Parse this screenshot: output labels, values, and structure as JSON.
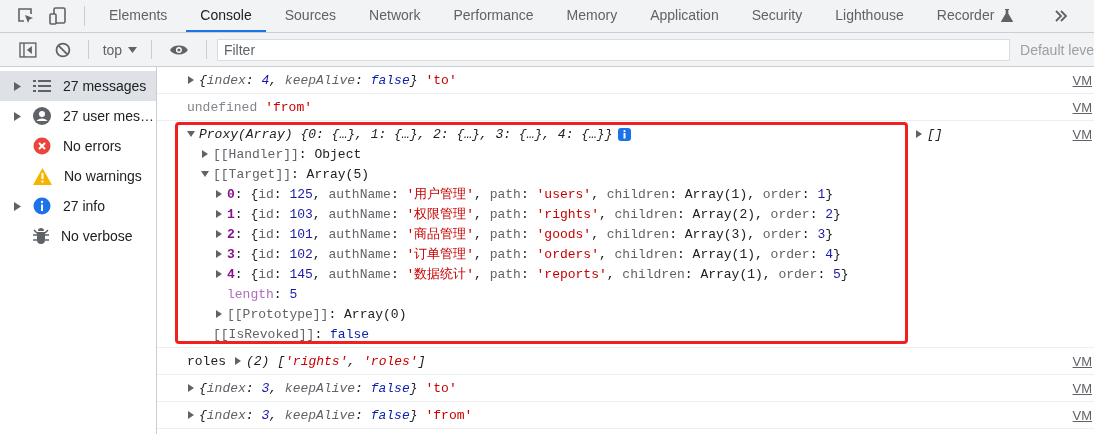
{
  "tabs": [
    {
      "label": "Elements",
      "selected": false
    },
    {
      "label": "Console",
      "selected": true
    },
    {
      "label": "Sources",
      "selected": false
    },
    {
      "label": "Network",
      "selected": false
    },
    {
      "label": "Performance",
      "selected": false
    },
    {
      "label": "Memory",
      "selected": false
    },
    {
      "label": "Application",
      "selected": false
    },
    {
      "label": "Security",
      "selected": false
    },
    {
      "label": "Lighthouse",
      "selected": false
    },
    {
      "label": "Recorder",
      "selected": false,
      "experimental": true
    }
  ],
  "toolbar": {
    "context": "top",
    "filter": {
      "placeholder": "Filter"
    },
    "levels": "Default leve"
  },
  "sidebar": {
    "items": [
      {
        "label": "27 messages",
        "kind": "list",
        "expandable": true,
        "selected": true
      },
      {
        "label": "27 user mes…",
        "kind": "user",
        "expandable": true,
        "selected": false
      },
      {
        "label": "No errors",
        "kind": "error",
        "expandable": false,
        "selected": false
      },
      {
        "label": "No warnings",
        "kind": "warning",
        "expandable": false,
        "selected": false
      },
      {
        "label": "27 info",
        "kind": "info",
        "expandable": true,
        "selected": false
      },
      {
        "label": "No verbose",
        "kind": "verbose",
        "expandable": false,
        "selected": false
      }
    ]
  },
  "console": [
    {
      "source": "VM",
      "args": [
        {
          "kind": "expandable",
          "expanded": false,
          "parts": [
            {
              "kind": "iplain",
              "text": "{"
            },
            {
              "kind": "iprop",
              "text": "index"
            },
            {
              "kind": "iplain",
              "text": ": "
            },
            {
              "kind": "inum",
              "text": "4"
            },
            {
              "kind": "iplain",
              "text": ", "
            },
            {
              "kind": "iprop",
              "text": "keepAlive"
            },
            {
              "kind": "iplain",
              "text": ": "
            },
            {
              "kind": "ibool",
              "text": "false"
            },
            {
              "kind": "iplain",
              "text": "}"
            }
          ]
        },
        {
          "kind": "plain",
          "parts": [
            {
              "kind": "str",
              "text": "'to'"
            }
          ]
        }
      ]
    },
    {
      "source": "VM",
      "args": [
        {
          "kind": "plain",
          "parts": [
            {
              "kind": "muted",
              "text": "undefined"
            }
          ]
        },
        {
          "kind": "plain",
          "parts": [
            {
              "kind": "str",
              "text": "'from'"
            }
          ]
        }
      ]
    },
    {
      "source": "VM",
      "highlighted": true,
      "args": [
        {
          "kind": "expandable",
          "expanded": true,
          "info_badge": true,
          "parts": [
            {
              "kind": "iplain",
              "text": "Proxy(Array) {0: {…}, 1: {…}, 2: {…}, 3: {…}, 4: {…}}"
            }
          ],
          "children": [
            {
              "kind": "branch",
              "expanded": false,
              "parts": [
                {
                  "kind": "prop",
                  "text": "[[Handler]]"
                },
                {
                  "kind": "plain",
                  "text": ": Object"
                }
              ]
            },
            {
              "kind": "branch",
              "expanded": true,
              "parts": [
                {
                  "kind": "prop",
                  "text": "[[Target]]"
                },
                {
                  "kind": "plain",
                  "text": ": Array(5)"
                }
              ],
              "children": [
                {
                  "kind": "branch",
                  "expanded": false,
                  "parts": [
                    {
                      "kind": "index",
                      "text": "0"
                    },
                    {
                      "kind": "plain",
                      "text": ": {"
                    },
                    {
                      "kind": "prop",
                      "text": "id"
                    },
                    {
                      "kind": "plain",
                      "text": ": "
                    },
                    {
                      "kind": "num",
                      "text": "125"
                    },
                    {
                      "kind": "plain",
                      "text": ", "
                    },
                    {
                      "kind": "prop",
                      "text": "authName"
                    },
                    {
                      "kind": "plain",
                      "text": ": "
                    },
                    {
                      "kind": "str",
                      "text": "'用户管理'"
                    },
                    {
                      "kind": "plain",
                      "text": ", "
                    },
                    {
                      "kind": "prop",
                      "text": "path"
                    },
                    {
                      "kind": "plain",
                      "text": ": "
                    },
                    {
                      "kind": "str",
                      "text": "'users'"
                    },
                    {
                      "kind": "plain",
                      "text": ", "
                    },
                    {
                      "kind": "prop",
                      "text": "children"
                    },
                    {
                      "kind": "plain",
                      "text": ": Array(1), "
                    },
                    {
                      "kind": "prop",
                      "text": "order"
                    },
                    {
                      "kind": "plain",
                      "text": ": "
                    },
                    {
                      "kind": "num",
                      "text": "1"
                    },
                    {
                      "kind": "plain",
                      "text": "}"
                    }
                  ]
                },
                {
                  "kind": "branch",
                  "expanded": false,
                  "parts": [
                    {
                      "kind": "index",
                      "text": "1"
                    },
                    {
                      "kind": "plain",
                      "text": ": {"
                    },
                    {
                      "kind": "prop",
                      "text": "id"
                    },
                    {
                      "kind": "plain",
                      "text": ": "
                    },
                    {
                      "kind": "num",
                      "text": "103"
                    },
                    {
                      "kind": "plain",
                      "text": ", "
                    },
                    {
                      "kind": "prop",
                      "text": "authName"
                    },
                    {
                      "kind": "plain",
                      "text": ": "
                    },
                    {
                      "kind": "str",
                      "text": "'权限管理'"
                    },
                    {
                      "kind": "plain",
                      "text": ", "
                    },
                    {
                      "kind": "prop",
                      "text": "path"
                    },
                    {
                      "kind": "plain",
                      "text": ": "
                    },
                    {
                      "kind": "str",
                      "text": "'rights'"
                    },
                    {
                      "kind": "plain",
                      "text": ", "
                    },
                    {
                      "kind": "prop",
                      "text": "children"
                    },
                    {
                      "kind": "plain",
                      "text": ": Array(2), "
                    },
                    {
                      "kind": "prop",
                      "text": "order"
                    },
                    {
                      "kind": "plain",
                      "text": ": "
                    },
                    {
                      "kind": "num",
                      "text": "2"
                    },
                    {
                      "kind": "plain",
                      "text": "}"
                    }
                  ]
                },
                {
                  "kind": "branch",
                  "expanded": false,
                  "parts": [
                    {
                      "kind": "index",
                      "text": "2"
                    },
                    {
                      "kind": "plain",
                      "text": ": {"
                    },
                    {
                      "kind": "prop",
                      "text": "id"
                    },
                    {
                      "kind": "plain",
                      "text": ": "
                    },
                    {
                      "kind": "num",
                      "text": "101"
                    },
                    {
                      "kind": "plain",
                      "text": ", "
                    },
                    {
                      "kind": "prop",
                      "text": "authName"
                    },
                    {
                      "kind": "plain",
                      "text": ": "
                    },
                    {
                      "kind": "str",
                      "text": "'商品管理'"
                    },
                    {
                      "kind": "plain",
                      "text": ", "
                    },
                    {
                      "kind": "prop",
                      "text": "path"
                    },
                    {
                      "kind": "plain",
                      "text": ": "
                    },
                    {
                      "kind": "str",
                      "text": "'goods'"
                    },
                    {
                      "kind": "plain",
                      "text": ", "
                    },
                    {
                      "kind": "prop",
                      "text": "children"
                    },
                    {
                      "kind": "plain",
                      "text": ": Array(3), "
                    },
                    {
                      "kind": "prop",
                      "text": "order"
                    },
                    {
                      "kind": "plain",
                      "text": ": "
                    },
                    {
                      "kind": "num",
                      "text": "3"
                    },
                    {
                      "kind": "plain",
                      "text": "}"
                    }
                  ]
                },
                {
                  "kind": "branch",
                  "expanded": false,
                  "parts": [
                    {
                      "kind": "index",
                      "text": "3"
                    },
                    {
                      "kind": "plain",
                      "text": ": {"
                    },
                    {
                      "kind": "prop",
                      "text": "id"
                    },
                    {
                      "kind": "plain",
                      "text": ": "
                    },
                    {
                      "kind": "num",
                      "text": "102"
                    },
                    {
                      "kind": "plain",
                      "text": ", "
                    },
                    {
                      "kind": "prop",
                      "text": "authName"
                    },
                    {
                      "kind": "plain",
                      "text": ": "
                    },
                    {
                      "kind": "str",
                      "text": "'订单管理'"
                    },
                    {
                      "kind": "plain",
                      "text": ", "
                    },
                    {
                      "kind": "prop",
                      "text": "path"
                    },
                    {
                      "kind": "plain",
                      "text": ": "
                    },
                    {
                      "kind": "str",
                      "text": "'orders'"
                    },
                    {
                      "kind": "plain",
                      "text": ", "
                    },
                    {
                      "kind": "prop",
                      "text": "children"
                    },
                    {
                      "kind": "plain",
                      "text": ": Array(1), "
                    },
                    {
                      "kind": "prop",
                      "text": "order"
                    },
                    {
                      "kind": "plain",
                      "text": ": "
                    },
                    {
                      "kind": "num",
                      "text": "4"
                    },
                    {
                      "kind": "plain",
                      "text": "}"
                    }
                  ]
                },
                {
                  "kind": "branch",
                  "expanded": false,
                  "parts": [
                    {
                      "kind": "index",
                      "text": "4"
                    },
                    {
                      "kind": "plain",
                      "text": ": {"
                    },
                    {
                      "kind": "prop",
                      "text": "id"
                    },
                    {
                      "kind": "plain",
                      "text": ": "
                    },
                    {
                      "kind": "num",
                      "text": "145"
                    },
                    {
                      "kind": "plain",
                      "text": ", "
                    },
                    {
                      "kind": "prop",
                      "text": "authName"
                    },
                    {
                      "kind": "plain",
                      "text": ": "
                    },
                    {
                      "kind": "str",
                      "text": "'数据统计'"
                    },
                    {
                      "kind": "plain",
                      "text": ", "
                    },
                    {
                      "kind": "prop",
                      "text": "path"
                    },
                    {
                      "kind": "plain",
                      "text": ": "
                    },
                    {
                      "kind": "str",
                      "text": "'reports'"
                    },
                    {
                      "kind": "plain",
                      "text": ", "
                    },
                    {
                      "kind": "prop",
                      "text": "children"
                    },
                    {
                      "kind": "plain",
                      "text": ": Array(1), "
                    },
                    {
                      "kind": "prop",
                      "text": "order"
                    },
                    {
                      "kind": "plain",
                      "text": ": "
                    },
                    {
                      "kind": "num",
                      "text": "5"
                    },
                    {
                      "kind": "plain",
                      "text": "}"
                    }
                  ]
                },
                {
                  "kind": "leaf",
                  "parts": [
                    {
                      "kind": "len",
                      "text": "length"
                    },
                    {
                      "kind": "plain",
                      "text": ": "
                    },
                    {
                      "kind": "num",
                      "text": "5"
                    }
                  ]
                },
                {
                  "kind": "branch",
                  "expanded": false,
                  "parts": [
                    {
                      "kind": "prop",
                      "text": "[[Prototype]]"
                    },
                    {
                      "kind": "plain",
                      "text": ": Array(0)"
                    }
                  ]
                }
              ]
            },
            {
              "kind": "leaf",
              "parts": [
                {
                  "kind": "prop",
                  "text": "[[IsRevoked]]"
                },
                {
                  "kind": "plain",
                  "text": ": "
                },
                {
                  "kind": "bool",
                  "text": "false"
                }
              ]
            }
          ]
        },
        {
          "kind": "trailing",
          "expanded": false,
          "parts": [
            {
              "kind": "iplain",
              "text": "[]"
            }
          ]
        }
      ]
    },
    {
      "source": "VM",
      "args": [
        {
          "kind": "plain",
          "parts": [
            {
              "kind": "plain",
              "text": "roles"
            }
          ]
        },
        {
          "kind": "expandable",
          "expanded": false,
          "parts": [
            {
              "kind": "iplain",
              "text": "(2) ["
            },
            {
              "kind": "istr",
              "text": "'rights'"
            },
            {
              "kind": "iplain",
              "text": ", "
            },
            {
              "kind": "istr",
              "text": "'roles'"
            },
            {
              "kind": "iplain",
              "text": "]"
            }
          ]
        }
      ]
    },
    {
      "source": "VM",
      "args": [
        {
          "kind": "expandable",
          "expanded": false,
          "parts": [
            {
              "kind": "iplain",
              "text": "{"
            },
            {
              "kind": "iprop",
              "text": "index"
            },
            {
              "kind": "iplain",
              "text": ": "
            },
            {
              "kind": "inum",
              "text": "3"
            },
            {
              "kind": "iplain",
              "text": ", "
            },
            {
              "kind": "iprop",
              "text": "keepAlive"
            },
            {
              "kind": "iplain",
              "text": ": "
            },
            {
              "kind": "ibool",
              "text": "false"
            },
            {
              "kind": "iplain",
              "text": "}"
            }
          ]
        },
        {
          "kind": "plain",
          "parts": [
            {
              "kind": "str",
              "text": "'to'"
            }
          ]
        }
      ]
    },
    {
      "source": "VM",
      "args": [
        {
          "kind": "expandable",
          "expanded": false,
          "parts": [
            {
              "kind": "iplain",
              "text": "{"
            },
            {
              "kind": "iprop",
              "text": "index"
            },
            {
              "kind": "iplain",
              "text": ": "
            },
            {
              "kind": "inum",
              "text": "3"
            },
            {
              "kind": "iplain",
              "text": ", "
            },
            {
              "kind": "iprop",
              "text": "keepAlive"
            },
            {
              "kind": "iplain",
              "text": ": "
            },
            {
              "kind": "ibool",
              "text": "false"
            },
            {
              "kind": "iplain",
              "text": "}"
            }
          ]
        },
        {
          "kind": "plain",
          "parts": [
            {
              "kind": "str",
              "text": "'from'"
            }
          ]
        }
      ]
    }
  ]
}
